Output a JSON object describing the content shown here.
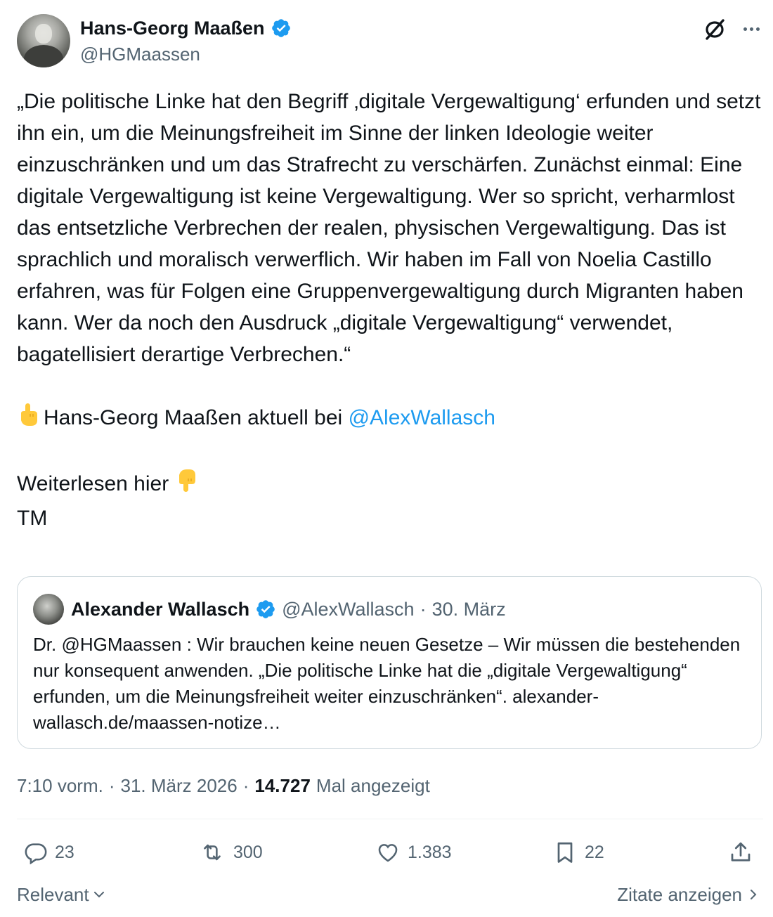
{
  "author": {
    "name": "Hans-Georg Maaßen",
    "handle": "@HGMaassen"
  },
  "tweet": {
    "paragraph1": "„Die politische Linke hat den Begriff ‚digitale Vergewaltigung‘ erfunden und setzt ihn ein, um die Meinungsfreiheit im Sinne der linken Ideologie weiter einzuschränken und um das Strafrecht zu verschärfen. Zunächst einmal: Eine digitale Vergewaltigung ist keine Vergewaltigung. Wer so spricht, verharmlost das entsetzliche Verbrechen der realen, physischen Vergewaltigung. Das ist sprachlich und moralisch verwerflich. Wir haben im Fall von Noelia Castillo erfahren, was für Folgen eine Gruppenvergewaltigung durch Migranten haben kann. Wer da noch den Ausdruck „digitale Vergewaltigung“ verwendet, bagatellisiert derartige Verbrechen.“",
    "line2_text": "Hans-Georg Maaßen aktuell bei ",
    "line2_mention": "@AlexWallasch",
    "line3": "Weiterlesen hier",
    "line4": "TM"
  },
  "quote": {
    "name": "Alexander Wallasch",
    "handle": "@AlexWallasch",
    "separator": "·",
    "date": "30. März",
    "text": "Dr. @HGMaassen : Wir brauchen keine neuen Gesetze – Wir müssen die bestehenden nur konsequent anwenden. „Die politische Linke hat die „digitale Vergewaltigung“ erfunden, um die Meinungsfreiheit weiter einzuschränken“. alexander-wallasch.de/maassen-notize…"
  },
  "meta": {
    "time": "7:10 vorm.",
    "sep1": "·",
    "date": "31. März 2026",
    "sep2": "·",
    "views": "14.727",
    "views_label": "Mal angezeigt"
  },
  "actions": {
    "replies": "23",
    "reposts": "300",
    "likes": "1.383",
    "bookmarks": "22"
  },
  "footer": {
    "sort_label": "Relevant",
    "quotes_label": "Zitate anzeigen"
  },
  "icons": {
    "verified": "verified-badge-icon",
    "grok": "grok-icon",
    "more": "more-icon",
    "reply": "reply-icon",
    "repost": "repost-icon",
    "like": "heart-icon",
    "bookmark": "bookmark-icon",
    "share": "share-icon",
    "point_up": "point-up-emoji",
    "point_down": "point-down-emoji"
  },
  "colors": {
    "accent": "#1d9bf0",
    "text": "#0f1419",
    "secondary": "#536471",
    "border": "#cfd9de"
  }
}
